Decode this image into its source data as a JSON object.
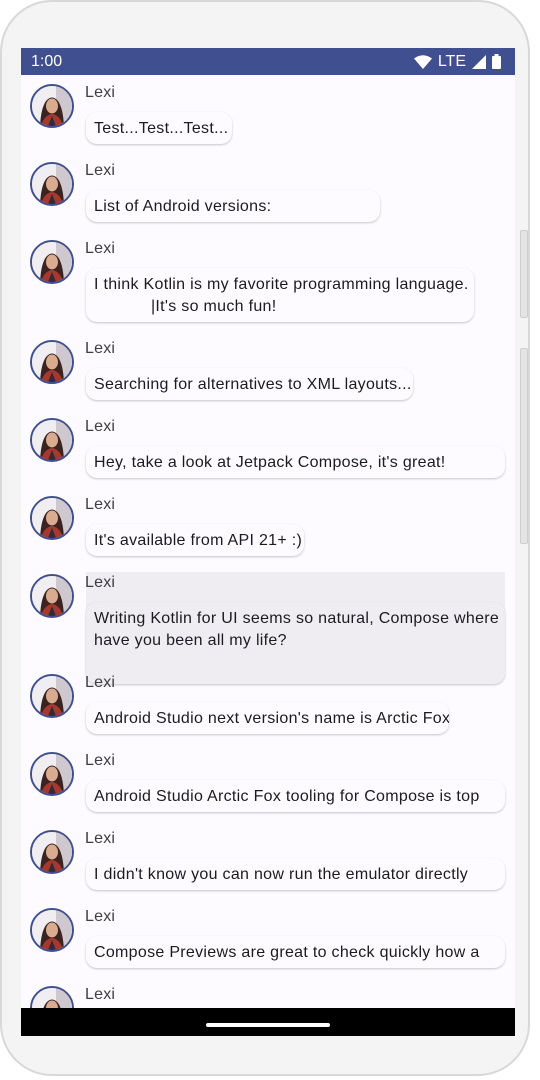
{
  "status_bar": {
    "time": "1:00",
    "network": "LTE",
    "icons": [
      "wifi-icon",
      "signal-icon",
      "battery-icon"
    ],
    "color": "#3f4f8f"
  },
  "messages": [
    {
      "author": "Lexi",
      "text": "Test...Test...Test..."
    },
    {
      "author": "Lexi",
      "text": "List of Android versions:"
    },
    {
      "author": "Lexi",
      "text": "I think Kotlin is my favorite programming language.\n            |It's so much fun!"
    },
    {
      "author": "Lexi",
      "text": "Searching for alternatives to XML layouts..."
    },
    {
      "author": "Lexi",
      "text": "Hey, take a look at Jetpack Compose, it's great!"
    },
    {
      "author": "Lexi",
      "text": "It's available from API 21+ :)"
    },
    {
      "author": "Lexi",
      "text": "Writing Kotlin for UI seems so natural, Compose where\nhave you been all my life?"
    },
    {
      "author": "Lexi",
      "text": "Android Studio next version's name is Arctic Fox"
    },
    {
      "author": "Lexi",
      "text": "Android Studio Arctic Fox tooling for Compose is top"
    },
    {
      "author": "Lexi",
      "text": "I didn't know you can now run the emulator directly"
    },
    {
      "author": "Lexi",
      "text": "Compose Previews are great to check quickly how a"
    },
    {
      "author": "Lexi",
      "text": ""
    }
  ]
}
